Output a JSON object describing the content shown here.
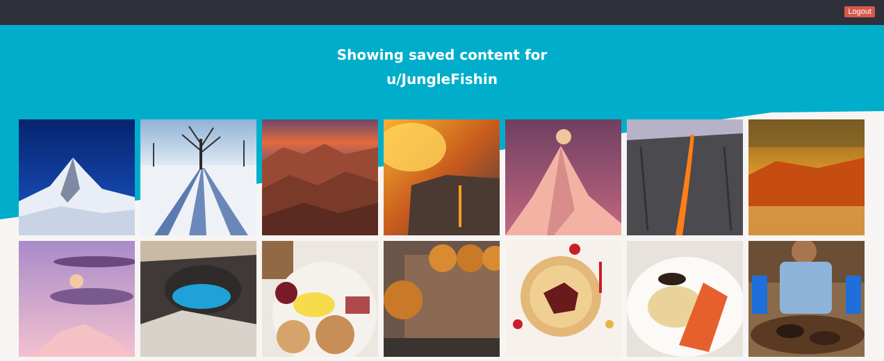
{
  "header": {
    "logout_label": "Logout"
  },
  "hero": {
    "line1": "Showing saved content for",
    "username": "u/JungleFishin",
    "color": "#00aecb"
  },
  "gallery": {
    "items": [
      {
        "subject": "snowy mountain peak against deep blue sky"
      },
      {
        "subject": "bare tree casting long shadows on snowfield"
      },
      {
        "subject": "red rock canyon at sunset"
      },
      {
        "subject": "glowing waterfall on cliff with fiery clouds"
      },
      {
        "subject": "full moon above pink snowy peak"
      },
      {
        "subject": "firefall waterfall on granite cliff"
      },
      {
        "subject": "autumn forest reflected in misty river"
      },
      {
        "subject": "moon and lenticular clouds over pink mountain"
      },
      {
        "subject": "blue crater lake among dark dunes"
      },
      {
        "subject": "breakfast plate with eggs, toast and jam"
      },
      {
        "subject": "tray of golden baked rolls"
      },
      {
        "subject": "decorated lunar new year pie with ox"
      },
      {
        "subject": "plated noodles with lobster"
      },
      {
        "subject": "man holding large platter of barbecue"
      }
    ]
  }
}
